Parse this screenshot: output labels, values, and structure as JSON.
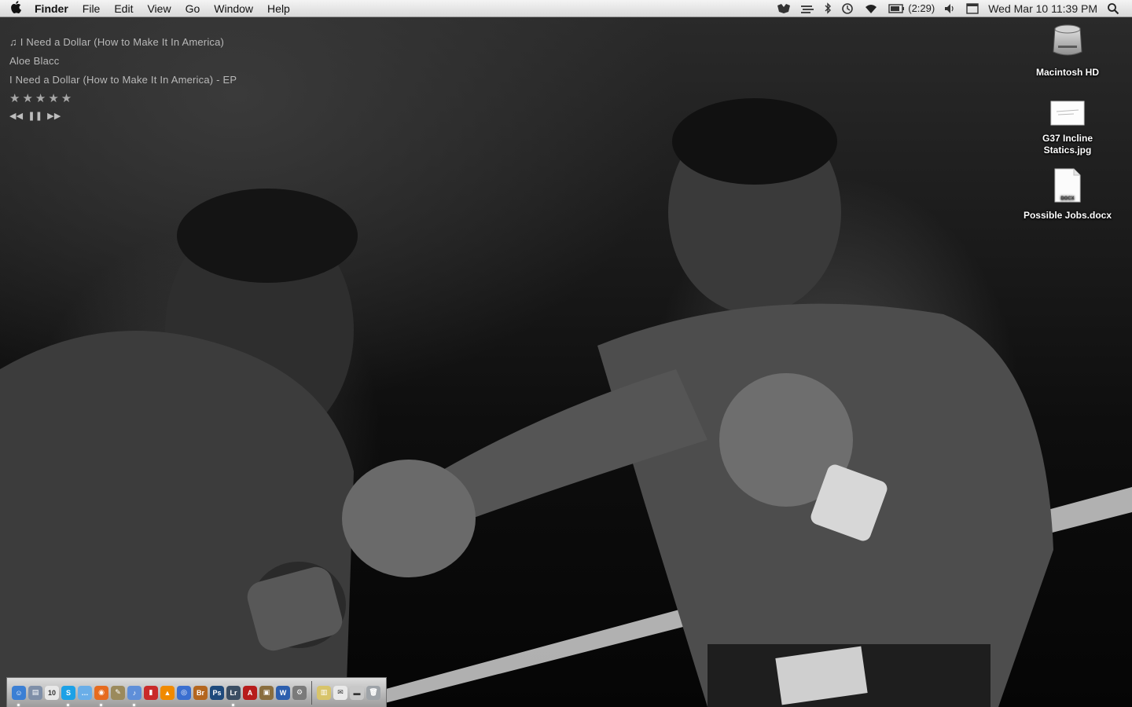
{
  "menubar": {
    "apple_icon": "apple-icon",
    "app_name": "Finder",
    "menus": [
      "File",
      "Edit",
      "View",
      "Go",
      "Window",
      "Help"
    ],
    "status": {
      "battery_time": "(2:29)",
      "datetime": "Wed Mar 10  11:39 PM",
      "icons": [
        "menu-extra-icon",
        "sync-icon",
        "bluetooth-icon",
        "time-machine-icon",
        "wifi-icon",
        "battery-icon",
        "volume-icon",
        "calendar-icon",
        "spotlight-icon"
      ]
    }
  },
  "now_playing": {
    "track": "I Need a Dollar (How to Make It In America)",
    "artist": "Aloe Blacc",
    "album": "I Need a Dollar (How to Make It In America) - EP",
    "rating": "★★★★★",
    "controls": {
      "previous": "◀◀",
      "pause": "❚❚",
      "next": "▶▶"
    }
  },
  "desktop_icons": [
    {
      "label": "Macintosh HD",
      "icon": "hard-drive-icon"
    },
    {
      "label_line1": "G37 Incline",
      "label_line2": "Statics.jpg",
      "icon": "image-file-icon"
    },
    {
      "label": "Possible Jobs.docx",
      "icon": "docx-file-icon",
      "badge": "DOCX"
    }
  ],
  "dock": {
    "apps": [
      {
        "name": "finder",
        "color": "#3b7fd4",
        "glyph": "☺"
      },
      {
        "name": "preview",
        "color": "#7f8fa8",
        "glyph": "▤"
      },
      {
        "name": "ical",
        "color": "#e8e8e8",
        "glyph": "10"
      },
      {
        "name": "skype",
        "color": "#1da1e6",
        "glyph": "S"
      },
      {
        "name": "ichat",
        "color": "#6aaee8",
        "glyph": "…"
      },
      {
        "name": "firefox",
        "color": "#e66b1f",
        "glyph": "◉"
      },
      {
        "name": "coda",
        "color": "#9b8a5c",
        "glyph": "✎"
      },
      {
        "name": "itunes",
        "color": "#5f8fd9",
        "glyph": "♪"
      },
      {
        "name": "ical-red",
        "color": "#c92a2a",
        "glyph": "▮"
      },
      {
        "name": "vlc",
        "color": "#f08a00",
        "glyph": "▲"
      },
      {
        "name": "safari",
        "color": "#3a6fd0",
        "glyph": "◎"
      },
      {
        "name": "bridge",
        "color": "#b4661e",
        "glyph": "Br"
      },
      {
        "name": "photoshop",
        "color": "#1e4a7c",
        "glyph": "Ps"
      },
      {
        "name": "lightroom",
        "color": "#3b4e63",
        "glyph": "Lr"
      },
      {
        "name": "acrobat",
        "color": "#b71c1c",
        "glyph": "A"
      },
      {
        "name": "image-app",
        "color": "#8a6e3f",
        "glyph": "▣"
      },
      {
        "name": "word",
        "color": "#2d5fae",
        "glyph": "W"
      },
      {
        "name": "system-app",
        "color": "#7a7a7a",
        "glyph": "⚙"
      }
    ],
    "stacks": [
      {
        "name": "documents-stack",
        "color": "#d8c46a",
        "glyph": "▥"
      },
      {
        "name": "mail-stack",
        "color": "#e9e9e9",
        "glyph": "✉"
      },
      {
        "name": "downloads-stack",
        "color": "#c8c8c8",
        "glyph": "▬"
      },
      {
        "name": "trash",
        "color": "#9ea3a8",
        "glyph": "🗑"
      }
    ]
  }
}
